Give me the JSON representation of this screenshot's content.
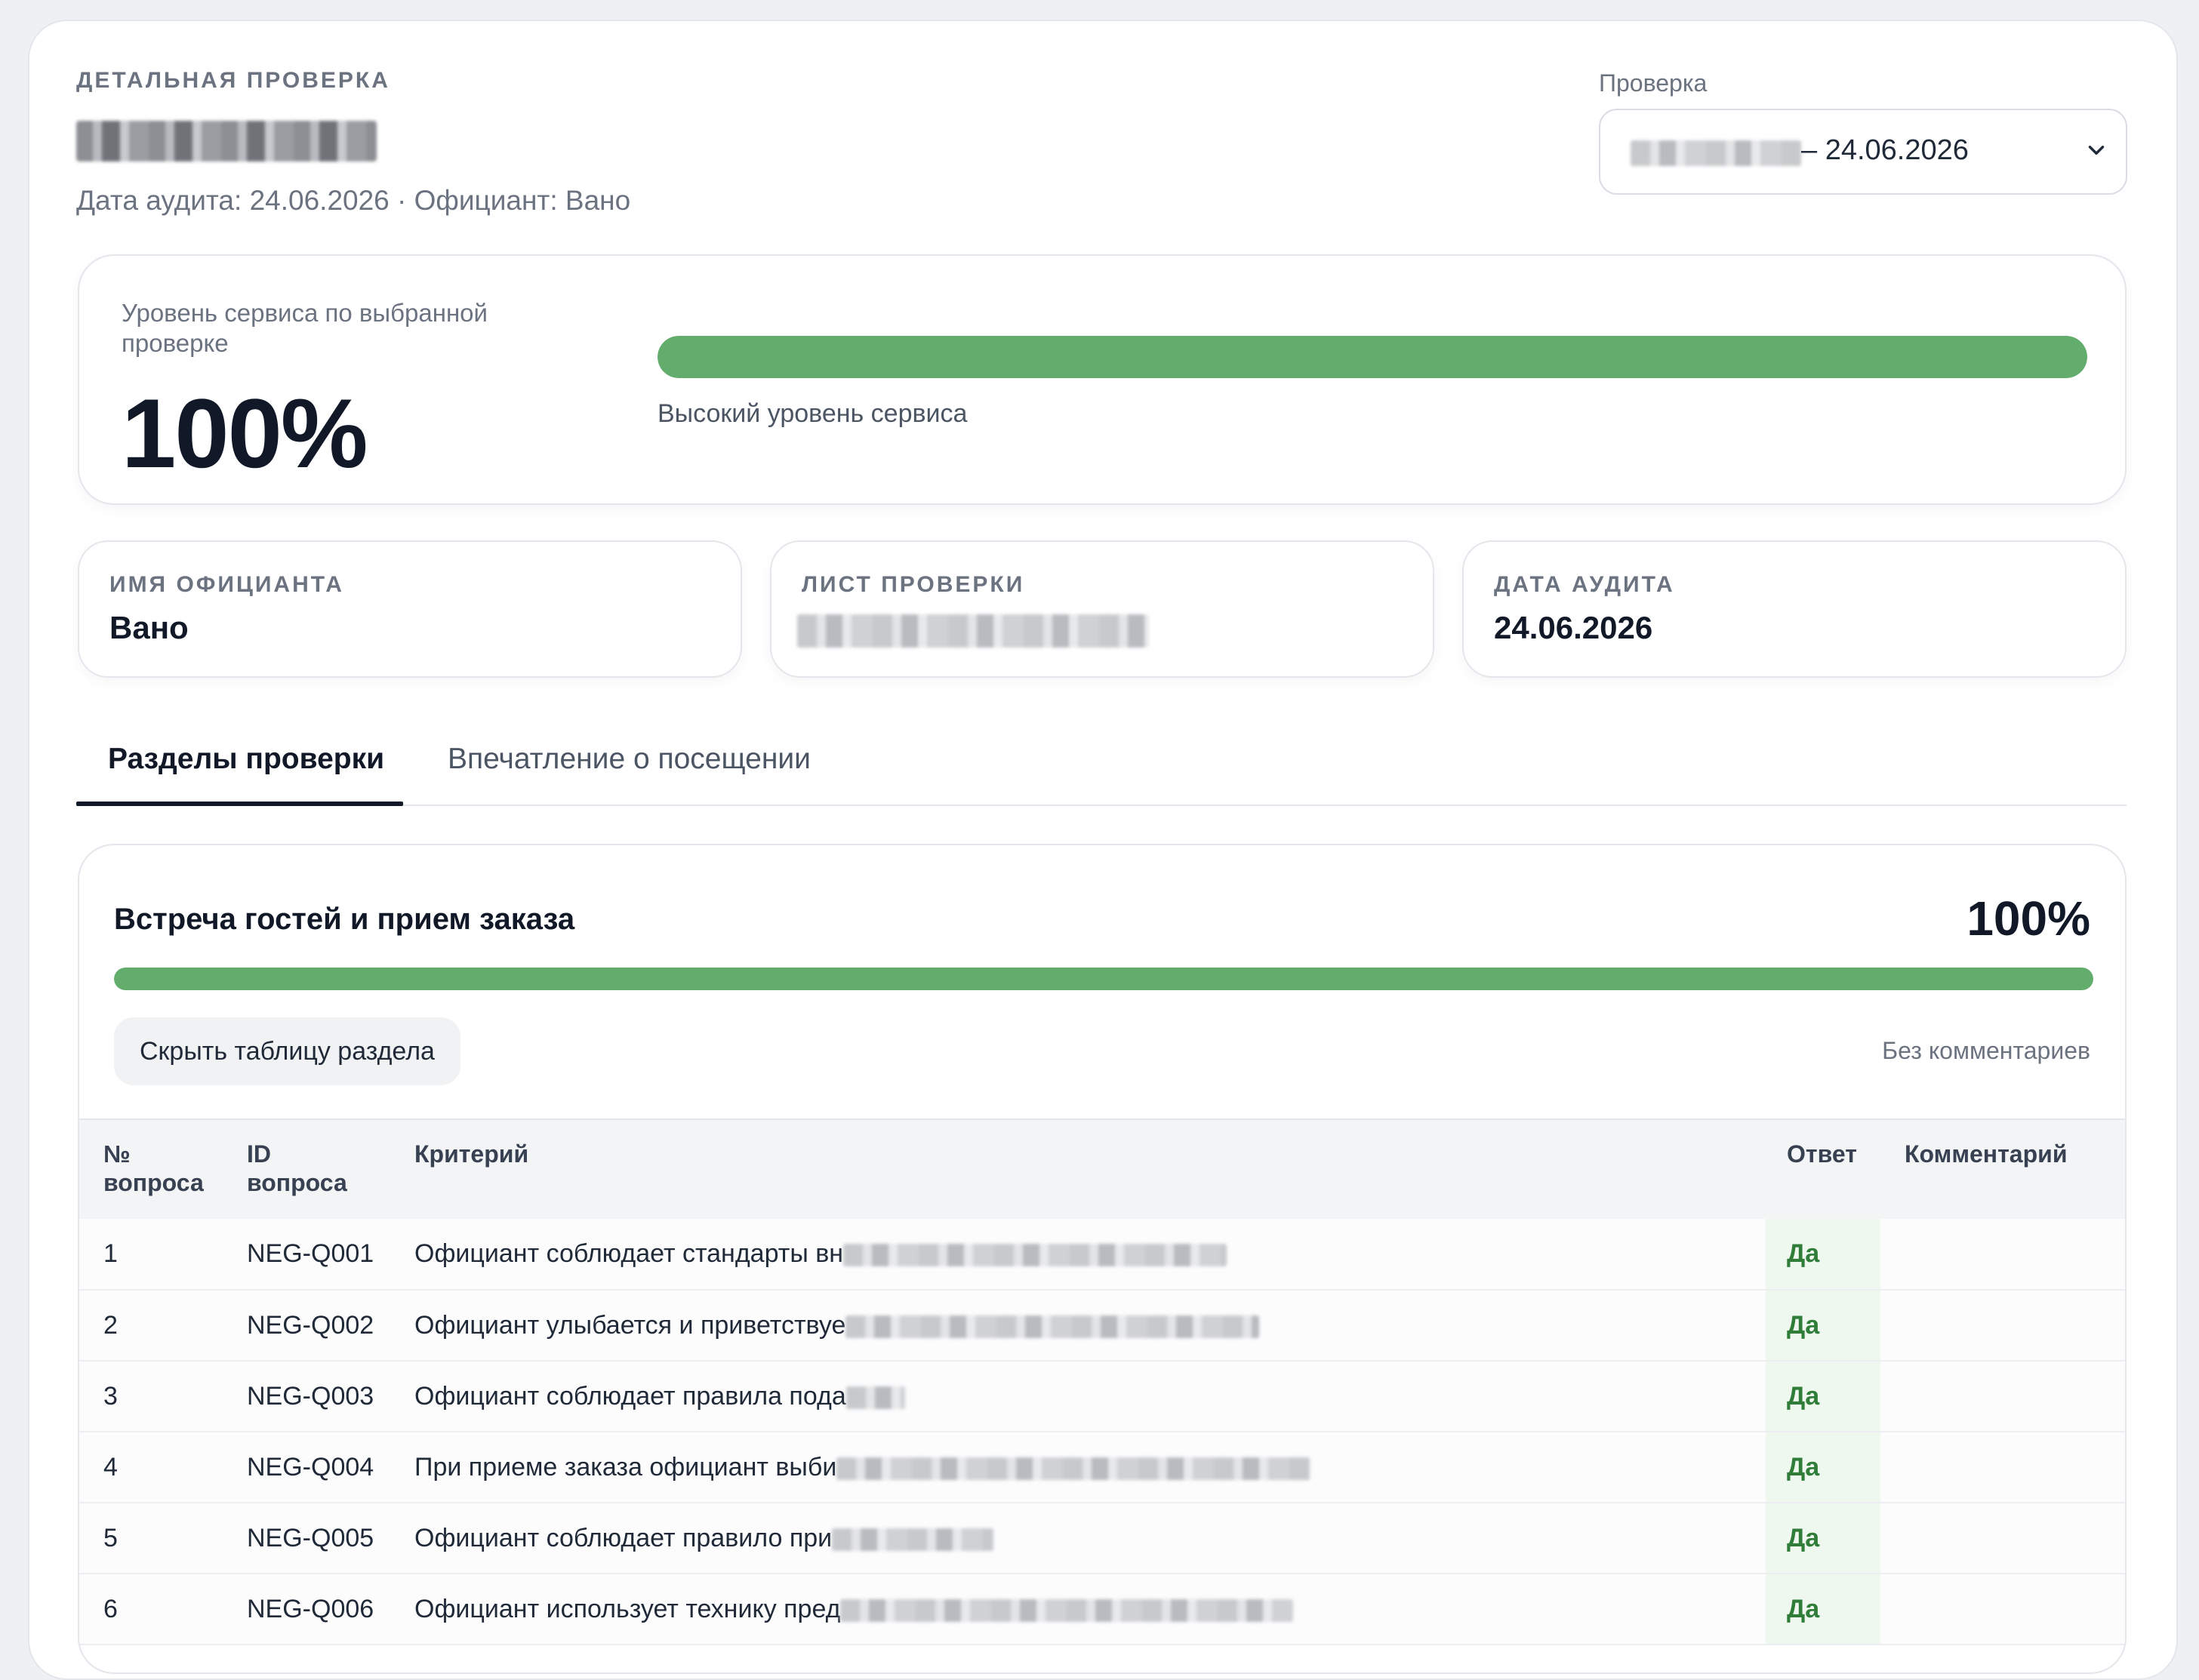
{
  "header": {
    "eyebrow": "ДЕТАЛЬНАЯ ПРОВЕРКА",
    "subline": "Дата аудита: 24.06.2026 · Официант: Вано"
  },
  "check_select": {
    "label": "Проверка",
    "value_suffix": "– 24.06.2026"
  },
  "service": {
    "label": "Уровень сервиса по выбранной проверке",
    "value": "100%",
    "level": 1.0,
    "description": "Высокий уровень сервиса"
  },
  "info_cards": [
    {
      "label": "ИМЯ ОФИЦИАНТА",
      "value": "Вано"
    },
    {
      "label": "ЛИСТ ПРОВЕРКИ",
      "value": ""
    },
    {
      "label": "ДАТА АУДИТА",
      "value": "24.06.2026"
    }
  ],
  "tabs": [
    {
      "label": "Разделы проверки",
      "active": true
    },
    {
      "label": "Впечатление о посещении",
      "active": false
    }
  ],
  "section": {
    "title": "Встреча гостей и прием заказа",
    "percent": "100%",
    "level": 1.0,
    "hide_button": "Скрыть таблицу раздела",
    "comments_status": "Без комментариев",
    "columns": [
      "№\nвопроса",
      "ID\nвопроса",
      "Критерий",
      "Ответ",
      "Комментарий"
    ],
    "rows": [
      {
        "num": "1",
        "id": "NEG-Q001",
        "criterion": "Официант соблюдает стандарты вн",
        "answer": "Да",
        "comment": ""
      },
      {
        "num": "2",
        "id": "NEG-Q002",
        "criterion": "Официант улыбается и приветствуе",
        "answer": "Да",
        "comment": ""
      },
      {
        "num": "3",
        "id": "NEG-Q003",
        "criterion": "Официант соблюдает правила пода",
        "answer": "Да",
        "comment": ""
      },
      {
        "num": "4",
        "id": "NEG-Q004",
        "criterion": "При приеме заказа официант выби",
        "answer": "Да",
        "comment": ""
      },
      {
        "num": "5",
        "id": "NEG-Q005",
        "criterion": "Официант соблюдает правило при",
        "answer": "Да",
        "comment": ""
      },
      {
        "num": "6",
        "id": "NEG-Q006",
        "criterion": "Официант использует технику пред",
        "answer": "Да",
        "comment": ""
      }
    ]
  },
  "colors": {
    "accent_green": "#62ad6b",
    "answer_green": "#2f7d38"
  }
}
